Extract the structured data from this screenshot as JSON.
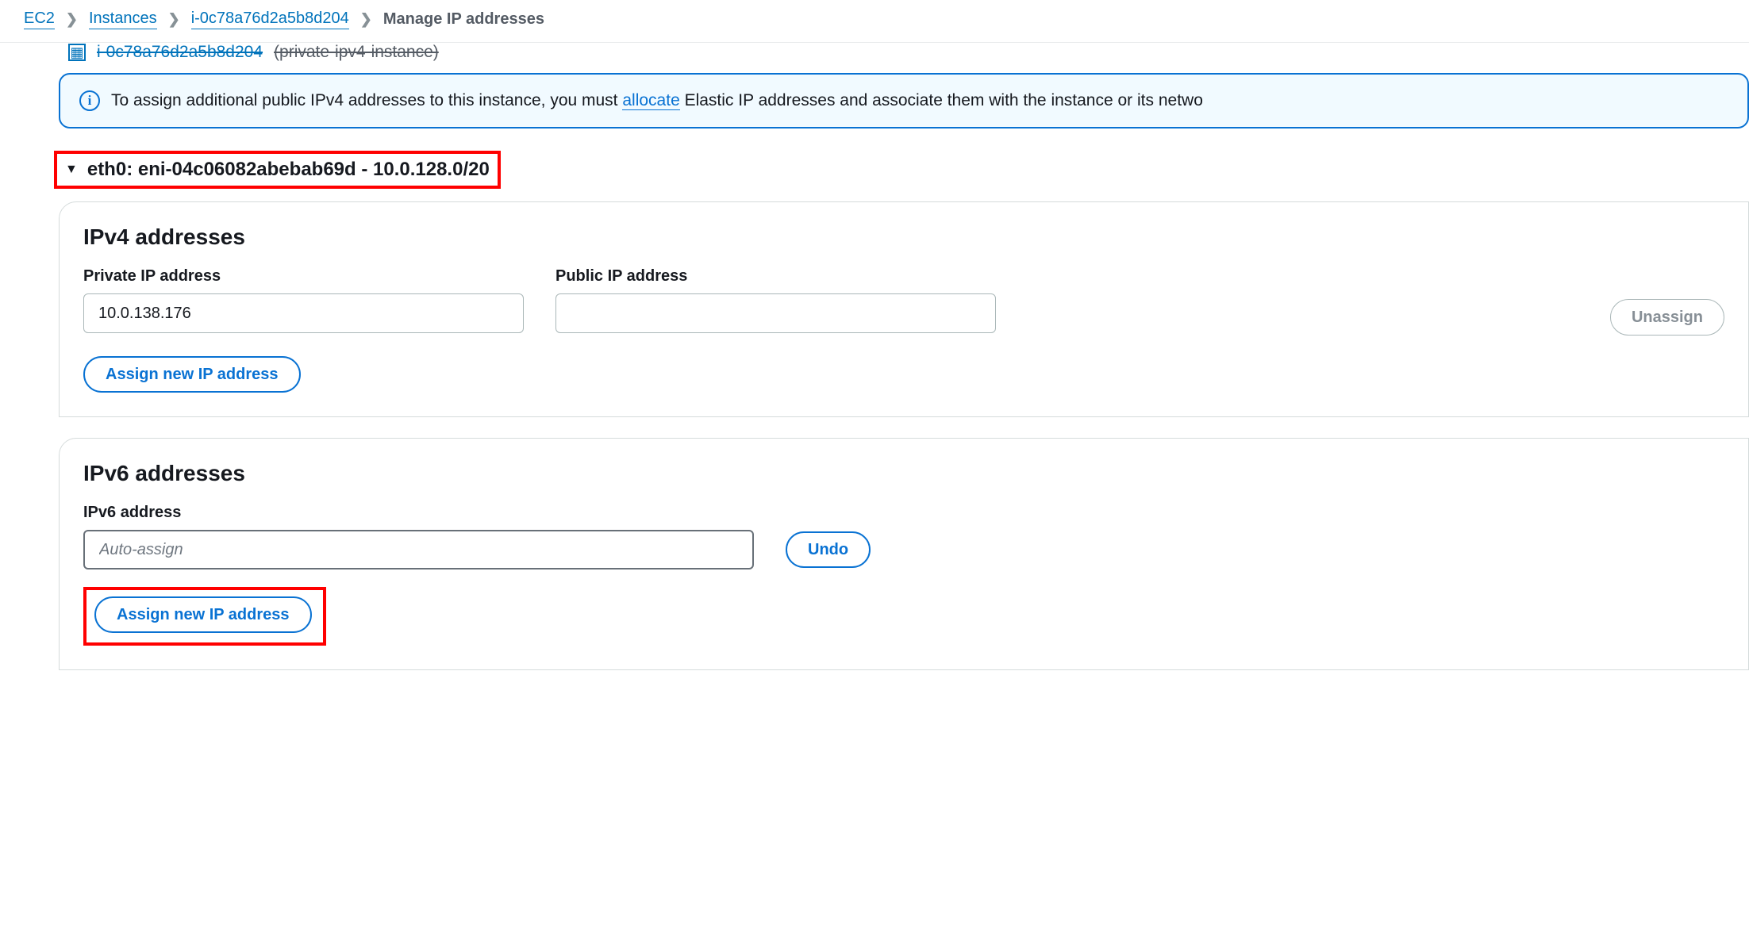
{
  "breadcrumb": {
    "ec2": "EC2",
    "instances": "Instances",
    "instance_id": "i-0c78a76d2a5b8d204",
    "current": "Manage IP addresses"
  },
  "header": {
    "instance_link": "i-0c78a76d2a5b8d204",
    "instance_paren": "(private-ipv4-instance)"
  },
  "banner": {
    "text_before": "To assign additional public IPv4 addresses to this instance, you must ",
    "link": "allocate",
    "text_after": " Elastic IP addresses and associate them with the instance or its netwo"
  },
  "eni": {
    "label": "eth0: eni-04c06082abebab69d - 10.0.128.0/20"
  },
  "ipv4": {
    "title": "IPv4 addresses",
    "private_label": "Private IP address",
    "private_value": "10.0.138.176",
    "public_label": "Public IP address",
    "public_value": "",
    "unassign": "Unassign",
    "assign_new": "Assign new IP address"
  },
  "ipv6": {
    "title": "IPv6 addresses",
    "label": "IPv6 address",
    "value": "",
    "placeholder": "Auto-assign",
    "undo": "Undo",
    "assign_new": "Assign new IP address"
  }
}
